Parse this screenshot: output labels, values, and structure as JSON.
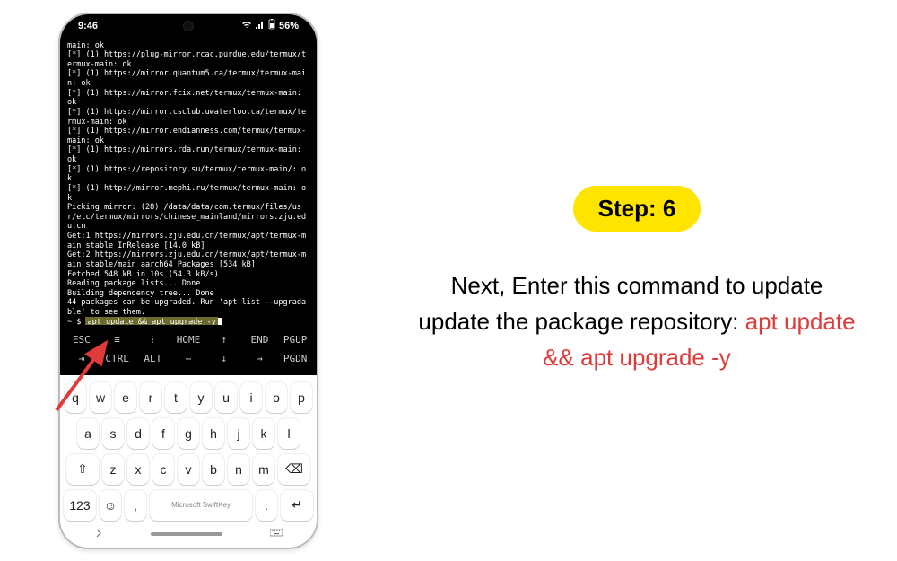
{
  "statusbar": {
    "time": "9:46",
    "battery": "56%"
  },
  "terminal": {
    "lines": [
      "main: ok",
      "[*] (1) https://plug-mirror.rcac.purdue.edu/termux/termux-main: ok",
      "[*] (1) https://mirror.quantum5.ca/termux/termux-main: ok",
      "[*] (1) https://mirror.fcix.net/termux/termux-main: ok",
      "[*] (1) https://mirror.csclub.uwaterloo.ca/termux/termux-main: ok",
      "[*] (1) https://mirror.endianness.com/termux/termux-main: ok",
      "[*] (1) https://mirrors.rda.run/termux/termux-main: ok",
      "[*] (1) https://repository.su/termux/termux-main/: ok",
      "[*] (1) http://mirror.mephi.ru/termux/termux-main: ok",
      "Picking mirror: (28) /data/data/com.termux/files/usr/etc/termux/mirrors/chinese_mainland/mirrors.zju.edu.cn",
      "Get:1 https://mirrors.zju.edu.cn/termux/apt/termux-main stable InRelease [14.0 kB]",
      "Get:2 https://mirrors.zju.edu.cn/termux/apt/termux-main stable/main aarch64 Packages [534 kB]",
      "Fetched 548 kB in 10s (54.3 kB/s)",
      "Reading package lists... Done",
      "Building dependency tree... Done",
      "44 packages can be upgraded. Run 'apt list --upgradable' to see them."
    ],
    "prompt": "~ $ ",
    "command": "apt update && apt upgrade -y"
  },
  "extra_keys": {
    "row1": [
      "ESC",
      "≡",
      "⁝",
      "HOME",
      "↑",
      "END",
      "PGUP"
    ],
    "row2": [
      "⇥",
      "CTRL",
      "ALT",
      "←",
      "↓",
      "→",
      "PGDN"
    ]
  },
  "keyboard": {
    "row1": [
      "q",
      "w",
      "e",
      "r",
      "t",
      "y",
      "u",
      "i",
      "o",
      "p"
    ],
    "row2": [
      "a",
      "s",
      "d",
      "f",
      "g",
      "h",
      "j",
      "k",
      "l"
    ],
    "row3": [
      "z",
      "x",
      "c",
      "v",
      "b",
      "n",
      "m"
    ],
    "shift": "⇧",
    "backspace": "⌫",
    "num": "123",
    "emoji": "☺",
    "comma": ",",
    "space": "Microsoft SwiftKey",
    "period": ".",
    "enter": "↵"
  },
  "annotation": {
    "step_label": "Step: 6",
    "instruction_pre": "Next, Enter this command to update update the package repository: ",
    "instruction_cmd": "apt update && apt upgrade -y"
  }
}
